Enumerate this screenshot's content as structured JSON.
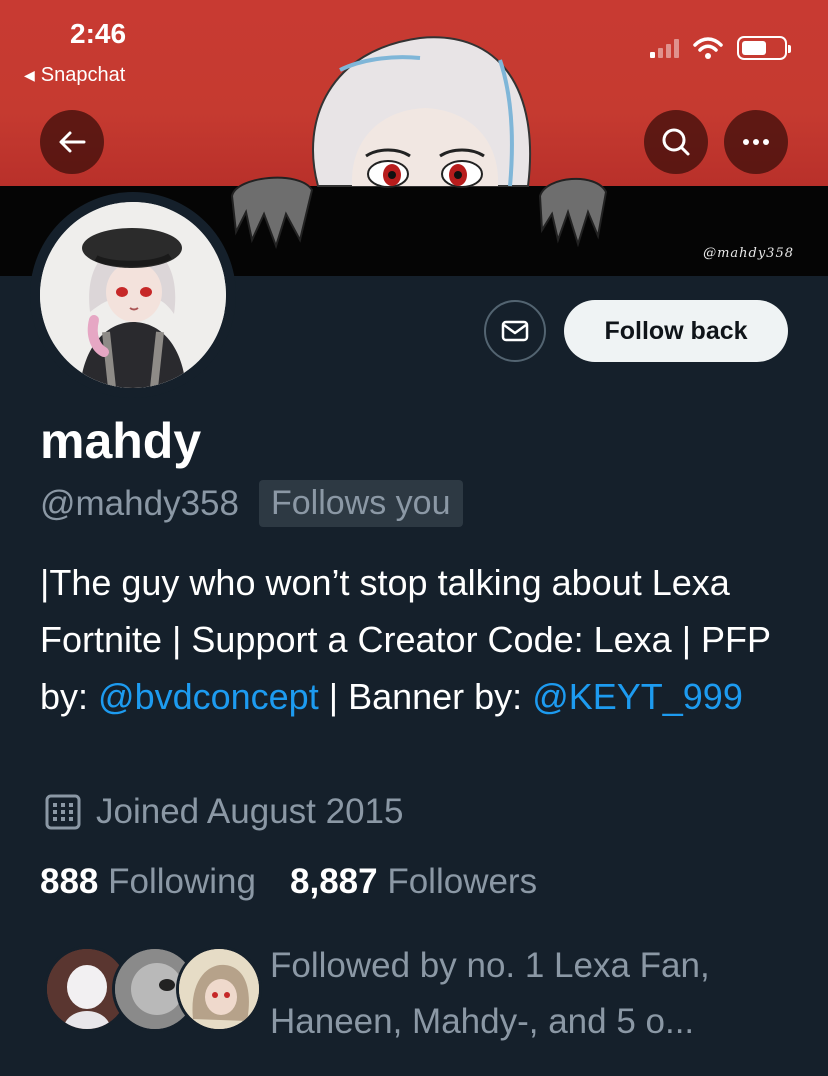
{
  "status_bar": {
    "time": "2:46",
    "back_app": "Snapchat",
    "battery_level": 0.6
  },
  "banner": {
    "credit": "@mahdy358",
    "colors": {
      "top": "#c83a32",
      "bottom": "#050505"
    }
  },
  "nav": {
    "back_icon": "arrow-left-icon",
    "search_icon": "search-icon",
    "more_icon": "more-dots-icon"
  },
  "actions": {
    "message_icon": "envelope-icon",
    "follow_label": "Follow back"
  },
  "profile": {
    "name": "mahdy",
    "handle": "@mahdy358",
    "follows_you": "Follows you",
    "bio_1": "|The guy who won’t stop talking about Lexa Fortnite | Support a Creator Code: Lexa | PFP by: ",
    "bio_link_1": "@bvdconcept",
    "bio_2": " | Banner by: ",
    "bio_link_2": "@KEYT_999",
    "joined": "Joined August 2015",
    "following_count": "888",
    "following_label": "Following",
    "followers_count": "8,887",
    "followers_label": "Followers",
    "followed_by": "Followed by no. 1 Lexa Fan, Haneen, Mahdy-, and 5 o..."
  },
  "theme": {
    "background": "#15202b",
    "accent": "#1d9bf0",
    "muted": "#8b98a5"
  }
}
